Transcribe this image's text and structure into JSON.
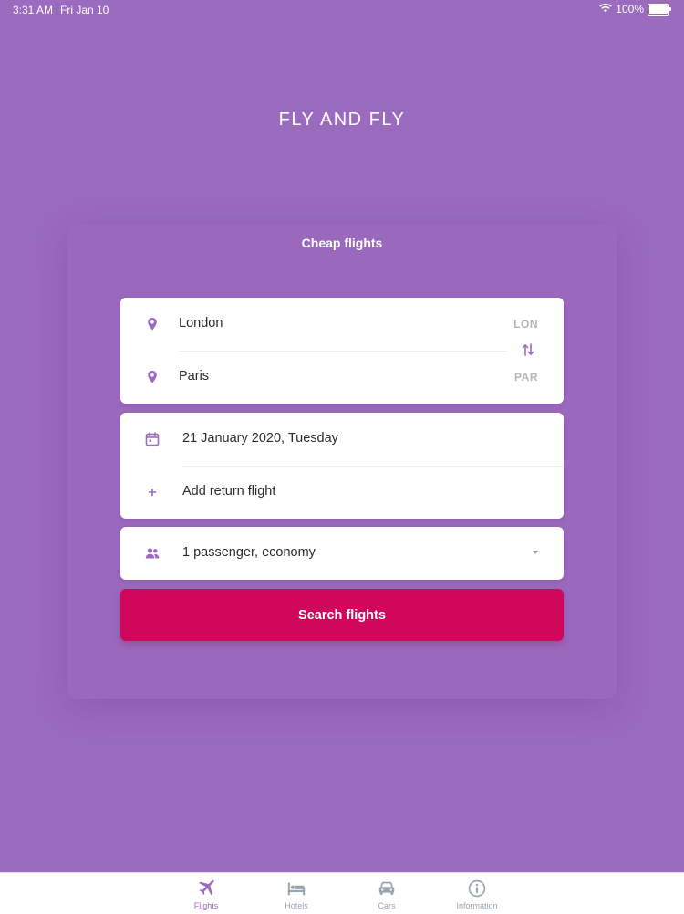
{
  "status_bar": {
    "time": "3:31 AM",
    "date": "Fri Jan 10",
    "battery": "100%",
    "battery_level": 1.0
  },
  "app": {
    "title": "FLY AND FLY"
  },
  "panel": {
    "title": "Cheap flights"
  },
  "route": {
    "from": {
      "city": "London",
      "code": "LON",
      "icon": "location-pin-icon"
    },
    "to": {
      "city": "Paris",
      "code": "PAR",
      "icon": "location-pin-icon"
    },
    "swap_icon": "swap-vertical-icon"
  },
  "dates": {
    "departure": "21 January 2020, Tuesday",
    "return_label": "Add return flight",
    "calendar_icon": "calendar-icon",
    "add_icon": "plus-icon"
  },
  "passengers": {
    "label": "1 passenger, economy",
    "icon": "people-icon"
  },
  "search_button": {
    "label": "Search flights"
  },
  "tabs": [
    {
      "label": "Flights",
      "icon": "airplane-icon",
      "active": true
    },
    {
      "label": "Hotels",
      "icon": "bed-icon",
      "active": false
    },
    {
      "label": "Cars",
      "icon": "car-icon",
      "active": false
    },
    {
      "label": "Information",
      "icon": "info-icon",
      "active": false
    }
  ],
  "colors": {
    "background": "#9b6bbf",
    "accent": "#9b6bbf",
    "search_button": "#d0075a",
    "tab_inactive": "#9aa3ad"
  }
}
